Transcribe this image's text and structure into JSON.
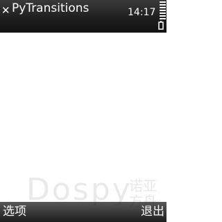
{
  "title_bar": {
    "close_icon": "close-icon",
    "title": "PyTransitions",
    "clock": "14:17",
    "battery_icon": "battery-icon",
    "battery_level": 1.0
  },
  "watermark": {
    "latin": "Dospy",
    "cjk": "诺亚方舟"
  },
  "softkeys": {
    "left": "选项",
    "right": "退出"
  },
  "colors": {
    "bar_dark": "#1f1f1f",
    "content_bg": "#ffffff",
    "text_light": "#ffffff"
  }
}
